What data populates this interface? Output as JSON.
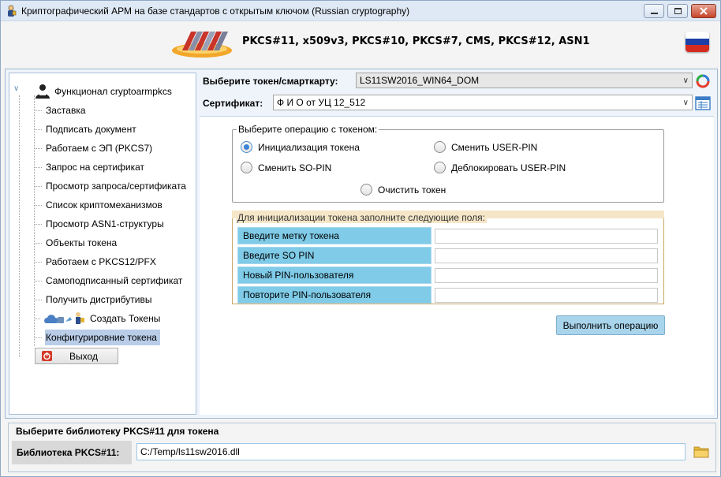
{
  "window": {
    "title": "Криптографический АРМ на базе стандартов с открытым ключом (Russian cryptography)"
  },
  "banner": {
    "standards_text": "PKCS#11, x509v3, PKCS#10, PKCS#7, CMS, PKCS#12, ASN1",
    "flag_colors": [
      "#ffffff",
      "#1c3fa8",
      "#d52b1e"
    ]
  },
  "sidebar": {
    "root_label": "Функционал cryptoarmpkcs",
    "items": [
      {
        "label": "Заставка"
      },
      {
        "label": "Подписать документ"
      },
      {
        "label": "Работаем с ЭП (PKCS7)"
      },
      {
        "label": "Запрос на сертификат"
      },
      {
        "label": "Просмотр запроса/сертификата"
      },
      {
        "label": "Список криптомеханизмов"
      },
      {
        "label": "Просмотр ASN1-структуры"
      },
      {
        "label": "Объекты токена"
      },
      {
        "label": "Работаем с PKCS12/PFX"
      },
      {
        "label": "Самоподписанный сертификат"
      },
      {
        "label": "Получить дистрибутивы"
      },
      {
        "label": "Создать Токены"
      },
      {
        "label": "Конфигурировние токена",
        "selected": true
      }
    ],
    "exit_label": "Выход"
  },
  "main": {
    "token_label": "Выберите токен/смарткарту:",
    "token_value": "LS11SW2016_WIN64_DOM",
    "cert_label": "Сертификат:",
    "cert_value": "Ф И О от УЦ 12_512",
    "operations": {
      "legend": "Выберите операцию с токеном:",
      "options": [
        {
          "label": "Инициализация токена",
          "checked": true
        },
        {
          "label": "Сменить USER-PIN",
          "checked": false
        },
        {
          "label": "Сменить SO-PIN",
          "checked": false
        },
        {
          "label": "Деблокировать USER-PIN",
          "checked": false
        },
        {
          "label": "Очистить токен",
          "checked": false
        }
      ]
    },
    "init": {
      "legend": "Для инициализации токена заполните следующие поля:",
      "fields": [
        {
          "label": "Введите метку токена",
          "value": ""
        },
        {
          "label": "Введите SO PIN",
          "value": ""
        },
        {
          "label": "Новый PIN-пользователя",
          "value": ""
        },
        {
          "label": "Повторите PIN-пользователя",
          "value": ""
        }
      ]
    },
    "execute_label": "Выполнить операцию"
  },
  "library": {
    "title": "Выберите библиотеку PKCS#11 для токена",
    "label": "Библиотека PKCS#11:",
    "path": "C:/Temp/ls11sw2016.dll"
  },
  "colors": {
    "field_label_bg": "#7fcbe8",
    "execute_button_bg": "#a8d4ec",
    "selected_item_bg": "#b9cde8"
  }
}
